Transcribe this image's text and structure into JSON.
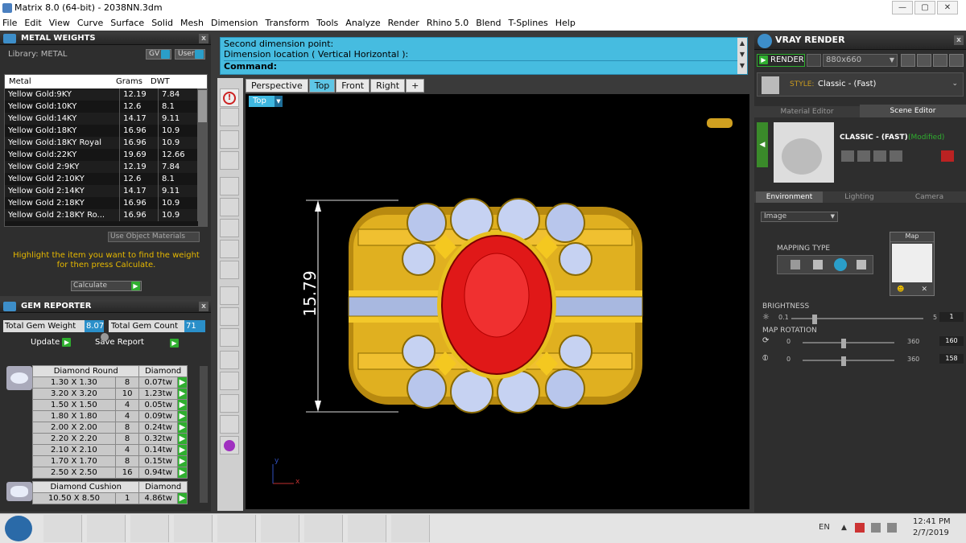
{
  "window": {
    "title": "Matrix 8.0 (64-bit) - 2038NN.3dm",
    "min": "—",
    "max": "▢",
    "close": "✕"
  },
  "menu": [
    "File",
    "Edit",
    "View",
    "Curve",
    "Surface",
    "Solid",
    "Mesh",
    "Dimension",
    "Transform",
    "Tools",
    "Analyze",
    "Render",
    "Rhino 5.0",
    "Blend",
    "T-Splines",
    "Help"
  ],
  "metal_weights": {
    "title": "METAL WEIGHTS",
    "library_label": "Library: METAL",
    "gv_label": "GV",
    "user_label": "User",
    "headers": [
      "Metal",
      "Grams",
      "DWT"
    ],
    "rows": [
      [
        "Yellow Gold:9KY",
        "12.19",
        "7.84"
      ],
      [
        "Yellow Gold:10KY",
        "12.6",
        "8.1"
      ],
      [
        "Yellow Gold:14KY",
        "14.17",
        "9.11"
      ],
      [
        "Yellow Gold:18KY",
        "16.96",
        "10.9"
      ],
      [
        "Yellow Gold:18KY Royal",
        "16.96",
        "10.9"
      ],
      [
        "Yellow Gold:22KY",
        "19.69",
        "12.66"
      ],
      [
        "Yellow Gold 2:9KY",
        "12.19",
        "7.84"
      ],
      [
        "Yellow Gold 2:10KY",
        "12.6",
        "8.1"
      ],
      [
        "Yellow Gold 2:14KY",
        "14.17",
        "9.11"
      ],
      [
        "Yellow Gold 2:18KY",
        "16.96",
        "10.9"
      ],
      [
        "Yellow Gold 2:18KY Ro...",
        "16.96",
        "10.9"
      ]
    ],
    "use_object_materials": "Use Object Materials",
    "hint": "Highlight the item you want to find the weight for then press Calculate.",
    "calculate": "Calculate"
  },
  "gem_reporter": {
    "title": "GEM REPORTER",
    "total_weight_label": "Total Gem Weight",
    "total_weight": "8.07",
    "total_count_label": "Total Gem Count",
    "total_count": "71",
    "update": "Update",
    "save_report": "Save Report",
    "group1": {
      "name": "Diamond Round",
      "material": "Diamond",
      "rows": [
        [
          "1.30 X 1.30",
          "8",
          "0.07tw"
        ],
        [
          "3.20 X 3.20",
          "10",
          "1.23tw"
        ],
        [
          "1.50 X 1.50",
          "4",
          "0.05tw"
        ],
        [
          "1.80 X 1.80",
          "4",
          "0.09tw"
        ],
        [
          "2.00 X 2.00",
          "8",
          "0.24tw"
        ],
        [
          "2.20 X 2.20",
          "8",
          "0.32tw"
        ],
        [
          "2.10 X 2.10",
          "4",
          "0.14tw"
        ],
        [
          "1.70 X 1.70",
          "8",
          "0.15tw"
        ],
        [
          "2.50 X 2.50",
          "16",
          "0.94tw"
        ]
      ]
    },
    "group2": {
      "name": "Diamond Cushion",
      "material": "Diamond",
      "rows": [
        [
          "10.50 X 8.50",
          "1",
          "4.86tw"
        ]
      ]
    }
  },
  "command": {
    "line1": "Second dimension point:",
    "line2": "Dimension location ( Vertical  Horizontal ):",
    "prompt": "Command:"
  },
  "viewport": {
    "tabs": [
      "Perspective",
      "Top",
      "Front",
      "Right"
    ],
    "active_tab": "Top",
    "name": "Top",
    "dimension": "15.79",
    "axis_x": "x",
    "axis_y": "y"
  },
  "vray": {
    "title": "VRAY RENDER",
    "render": "RENDER",
    "resolution": "880x660",
    "style_label": "STYLE:",
    "style_value": "Classic - (Fast)",
    "tab_material": "Material Editor",
    "tab_scene": "Scene Editor",
    "preset_name": "CLASSIC - (FAST)",
    "preset_status": "(Modified)",
    "env_tabs": [
      "Environment",
      "Lighting",
      "Camera"
    ],
    "env_type": "Image",
    "mapping_type": "MAPPING TYPE",
    "map_label": "Map",
    "brightness_label": "BRIGHTNESS",
    "brightness_min": "0.1",
    "brightness_max": "5",
    "brightness_value": "1",
    "rotation_label": "MAP ROTATION",
    "rot1_min": "0",
    "rot1_max": "360",
    "rot1_value": "160",
    "rot2_min": "0",
    "rot2_max": "360",
    "rot2_value": "158"
  },
  "taskbar": {
    "lang": "EN",
    "time": "12:41 PM",
    "date": "2/7/2019"
  }
}
